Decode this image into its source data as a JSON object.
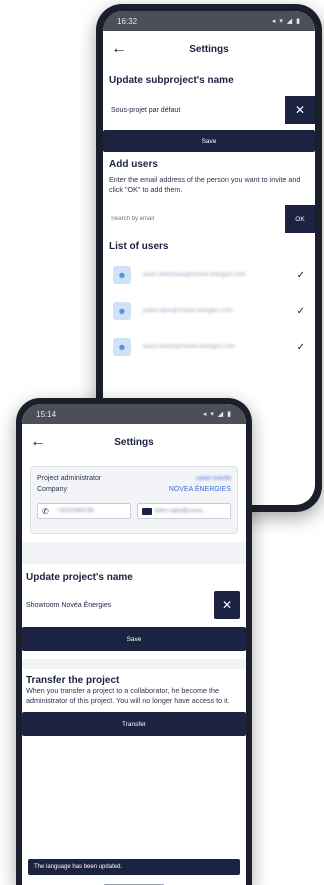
{
  "back_screen": {
    "status_time": "16:32",
    "status_icons": "◂ ▾ ◢ ▮",
    "title": "Settings",
    "subproject_section_title": "Update subproject's name",
    "subproject_name_value": "Sous-projet par défaut",
    "clear_icon": "✕",
    "save_label": "Save",
    "add_users_title": "Add users",
    "add_users_description": "Enter the email address of the person you want to invite and click \"OK\" to add them.",
    "search_placeholder": "Search by email",
    "ok_label": "OK",
    "list_users_title": "List of users",
    "users": [
      {
        "email": "julian.delumeau@novea-energies.com",
        "checked": "✓"
      },
      {
        "email": "julien.rapin@novea-energies.com",
        "checked": "✓"
      },
      {
        "email": "laura.martin@novea-energies.com",
        "checked": "✓"
      }
    ]
  },
  "front_screen": {
    "status_time": "15:14",
    "status_icons": "◂ ▾ ◢ ▮",
    "title": "Settings",
    "admin_card": {
      "admin_label": "Project administrator",
      "admin_name": "Julien RAPIN",
      "company_label": "Company",
      "company_value": "NOVEA ÉNERGIES",
      "phone": "+33123456789",
      "email": "julien.rapin@novea..."
    },
    "project_section_title": "Update project's name",
    "project_name_value": "Showroom Novéa Énergies",
    "clear_icon": "✕",
    "save_label": "Save",
    "transfer_title": "Transfer the project",
    "transfer_description": "When you transfer a project to a collaborator, he become the administrator of this project. You will no longer have access to it.",
    "transfer_label": "Transfer",
    "toast_message": "The language has been updated."
  },
  "colors": {
    "primary": "#1c2340",
    "accent_blue": "#3b6cd8",
    "avatar_bg": "#cfe2f7"
  }
}
